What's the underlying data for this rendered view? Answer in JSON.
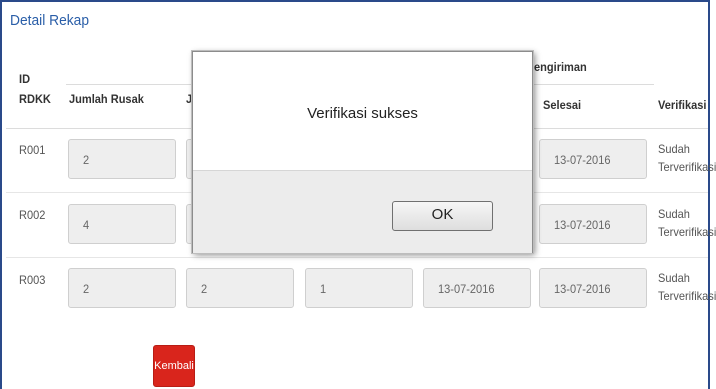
{
  "panel": {
    "title": "Detail Rekap"
  },
  "table": {
    "headers": {
      "id_line1": "ID",
      "id_line2": "RDKK",
      "jumlah_rusak": "Jumlah Rusak",
      "col2_partial": "J",
      "group_pengiriman_partial": "engiriman",
      "selesai": "Selesai",
      "verifikasi": "Verifikasi"
    },
    "rows": [
      {
        "id": "R001",
        "jumlah_rusak": "2",
        "selesai": "13-07-2016",
        "status_line1": "Sudah",
        "status_line2": "Terverifikasi"
      },
      {
        "id": "R002",
        "jumlah_rusak": "4",
        "selesai": "13-07-2016",
        "status_line1": "Sudah",
        "status_line2": "Terverifikasi"
      },
      {
        "id": "R003",
        "jumlah_rusak": "2",
        "col2": "2",
        "col3": "1",
        "col4": "13-07-2016",
        "selesai": "13-07-2016",
        "status_line1": "Sudah",
        "status_line2": "Terverifikasi"
      }
    ]
  },
  "buttons": {
    "kembali": "Kembali"
  },
  "dialog": {
    "message": "Verifikasi sukses",
    "ok": "OK"
  },
  "colors": {
    "title": "#2a5ea8",
    "kembali_bg": "#d9251c",
    "frame_border": "#2a4a8a"
  }
}
